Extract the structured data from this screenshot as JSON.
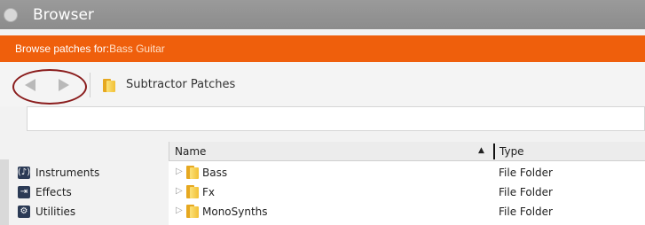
{
  "window": {
    "title": "Browser"
  },
  "context_bar": {
    "prefix": "Browse patches for: ",
    "current": "Bass Guitar"
  },
  "nav": {
    "path": "Subtractor Patches"
  },
  "search": {
    "value": "",
    "placeholder": ""
  },
  "sidebar": {
    "items": [
      {
        "label": "Instruments",
        "icon": "(♪)"
      },
      {
        "label": "Effects",
        "icon": "⇥"
      },
      {
        "label": "Utilities",
        "icon": "⚙"
      }
    ]
  },
  "table": {
    "columns": {
      "name": "Name",
      "type": "Type"
    },
    "sort_indicator": "▲",
    "rows": [
      {
        "name": "Bass",
        "type": "File Folder"
      },
      {
        "name": "Fx",
        "type": "File Folder"
      },
      {
        "name": "MonoSynths",
        "type": "File Folder"
      }
    ]
  },
  "colors": {
    "accent": "#ef5f0c",
    "titlebar": "#929292",
    "highlight_ring": "#8a1c1c"
  }
}
